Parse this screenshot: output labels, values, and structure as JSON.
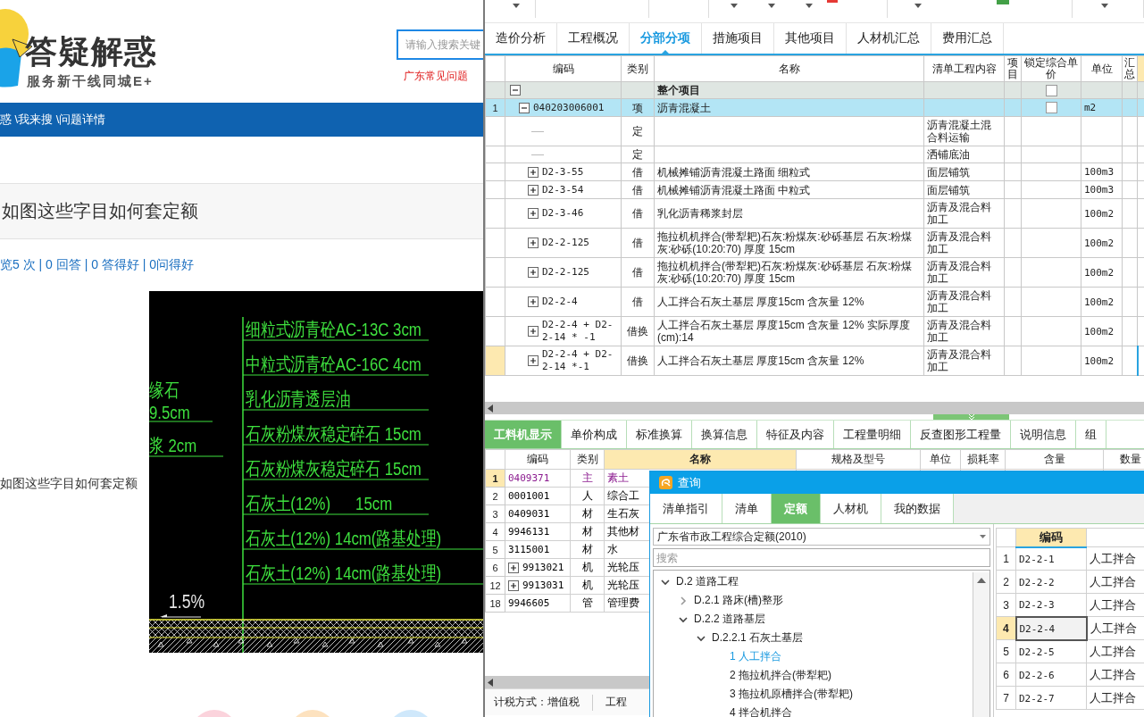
{
  "site": {
    "title": "答疑解惑",
    "slogan": "服务新干线同城E+",
    "search": {
      "placeholder": "请输入搜索关键"
    },
    "hot_link": "广东常见问题"
  },
  "breadcrumb": "惑 \\我来搜 \\问题详情",
  "question": {
    "title": "如图这些字目如何套定额",
    "stats": "览5 次 | 0 回答 | 0 答得好 | 0问得好",
    "body": "如图这些字目如何套定额",
    "cad": {
      "side_labels": [
        "缘石",
        "9.5cm",
        "浆 2cm"
      ],
      "layers": [
        "细粒式沥青砼AC-13C 3cm",
        "中粒式沥青砼AC-16C 4cm",
        "乳化沥青透层油",
        "石灰粉煤灰稳定碎石 15cm",
        "石灰粉煤灰稳定碎石 15cm",
        "石灰土(12%)      15cm",
        "石灰土(12%) 14cm(路基处理)",
        "石灰土(12%) 14cm(路基处理)"
      ],
      "slope": "1.5%"
    }
  },
  "app": {
    "main_tabs": [
      {
        "label": "造价分析",
        "selected": false
      },
      {
        "label": "工程概况",
        "selected": false
      },
      {
        "label": "分部分项",
        "selected": true
      },
      {
        "label": "措施项目",
        "selected": false
      },
      {
        "label": "其他项目",
        "selected": false
      },
      {
        "label": "人材机汇总",
        "selected": false
      },
      {
        "label": "费用汇总",
        "selected": false
      }
    ],
    "main_table": {
      "columns": [
        "编码",
        "类别",
        "名称",
        "清单工程内容",
        "项目",
        "锁定综合单价",
        "单位",
        "汇总"
      ],
      "rows": [
        {
          "kind": "group",
          "num": "",
          "code": "",
          "type": "",
          "name": "整个项目",
          "content": "",
          "unit": "",
          "expanded": true,
          "locked": false,
          "selected": false,
          "current": false
        },
        {
          "kind": "item",
          "num": "1",
          "code": "040203006001",
          "type": "项",
          "name": "沥青混凝土",
          "content": "",
          "unit": "m2",
          "expanded": true,
          "locked": false,
          "selected": true,
          "current": false
        },
        {
          "kind": "sub",
          "num": "",
          "code": "",
          "type": "定",
          "name": "",
          "content": "沥青混凝土混合料运输",
          "unit": "",
          "selected": false,
          "current": false
        },
        {
          "kind": "sub",
          "num": "",
          "code": "",
          "type": "定",
          "name": "",
          "content": "洒铺底油",
          "unit": "",
          "selected": false,
          "current": false
        },
        {
          "kind": "sub",
          "num": "",
          "code": "D2-3-55",
          "type": "借",
          "name": "机械摊铺沥青混凝土路面 细粒式",
          "content": "面层铺筑",
          "unit": "100m3",
          "expanded": false,
          "selected": false,
          "current": false
        },
        {
          "kind": "sub",
          "num": "",
          "code": "D2-3-54",
          "type": "借",
          "name": "机械摊铺沥青混凝土路面 中粒式",
          "content": "面层铺筑",
          "unit": "100m3",
          "expanded": false,
          "selected": false,
          "current": false
        },
        {
          "kind": "sub",
          "num": "",
          "code": "D2-3-46",
          "type": "借",
          "name": "乳化沥青稀浆封层",
          "content": "沥青及混合料加工",
          "unit": "100m2",
          "expanded": false,
          "selected": false,
          "current": false
        },
        {
          "kind": "sub",
          "num": "",
          "code": "D2-2-125",
          "type": "借",
          "name": "拖拉机机拌合(带犁耙)石灰:粉煤灰:砂砾基层 石灰:粉煤灰:砂砾(10:20:70) 厚度 15cm",
          "content": "沥青及混合料加工",
          "unit": "100m2",
          "expanded": false,
          "selected": false,
          "current": false
        },
        {
          "kind": "sub",
          "num": "",
          "code": "D2-2-125",
          "type": "借",
          "name": "拖拉机机拌合(带犁耙)石灰:粉煤灰:砂砾基层 石灰:粉煤灰:砂砾(10:20:70) 厚度 15cm",
          "content": "沥青及混合料加工",
          "unit": "100m2",
          "expanded": false,
          "selected": false,
          "current": false
        },
        {
          "kind": "sub",
          "num": "",
          "code": "D2-2-4",
          "type": "借",
          "name": "人工拌合石灰土基层 厚度15cm 含灰量 12%",
          "content": "沥青及混合料加工",
          "unit": "100m2",
          "expanded": false,
          "selected": false,
          "current": false
        },
        {
          "kind": "sub",
          "num": "",
          "code": "D2-2-4 + D2-2-14 * -1",
          "type": "借换",
          "name": "人工拌合石灰土基层 厚度15cm 含灰量 12%  实际厚度(cm):14",
          "content": "沥青及混合料加工",
          "unit": "100m2",
          "expanded": false,
          "selected": false,
          "current": false
        },
        {
          "kind": "sub",
          "num": "",
          "code": "D2-2-4 + D2-2-14 *-1",
          "type": "借换",
          "name": "人工拌合石灰土基层 厚度15cm 含灰量 12%",
          "content": "沥青及混合料加工",
          "unit": "100m2",
          "expanded": false,
          "selected": false,
          "current": true
        }
      ]
    },
    "detail_tabs": [
      {
        "label": "工料机显示",
        "selected": true
      },
      {
        "label": "单价构成",
        "selected": false
      },
      {
        "label": "标准换算",
        "selected": false
      },
      {
        "label": "换算信息",
        "selected": false
      },
      {
        "label": "特征及内容",
        "selected": false
      },
      {
        "label": "工程量明细",
        "selected": false
      },
      {
        "label": "反查图形工程量",
        "selected": false
      },
      {
        "label": "说明信息",
        "selected": false
      },
      {
        "label": "组",
        "selected": false
      }
    ],
    "detail_table": {
      "columns": [
        {
          "label": "编码",
          "selected": false
        },
        {
          "label": "类别",
          "selected": false
        },
        {
          "label": "名称",
          "selected": true
        },
        {
          "label": "规格及型号",
          "selected": false
        },
        {
          "label": "单位",
          "selected": false
        },
        {
          "label": "损耗率",
          "selected": false
        },
        {
          "label": "含量",
          "selected": false
        },
        {
          "label": "数量",
          "selected": false
        }
      ],
      "rows": [
        {
          "num": "1",
          "code": "0409371",
          "type": "主",
          "name": "素土",
          "color": "#8b1a8f",
          "current": true
        },
        {
          "num": "2",
          "code": "0001001",
          "type": "人",
          "name": "综合工",
          "color": "#000000",
          "current": false
        },
        {
          "num": "3",
          "code": "0409031",
          "type": "材",
          "name": "生石灰",
          "color": "#000000",
          "current": false
        },
        {
          "num": "4",
          "code": "9946131",
          "type": "材",
          "name": "其他材",
          "color": "#000000",
          "current": false
        },
        {
          "num": "5",
          "code": "3115001",
          "type": "材",
          "name": "水",
          "color": "#000000",
          "current": false
        },
        {
          "num": "6",
          "code": "9913021",
          "type": "机",
          "name": "光轮压",
          "color": "#000000",
          "current": false,
          "expanded": false
        },
        {
          "num": "12",
          "code": "9913031",
          "type": "机",
          "name": "光轮压",
          "color": "#000000",
          "current": false,
          "expanded": false
        },
        {
          "num": "18",
          "code": "9946605",
          "type": "管",
          "name": "管理费",
          "color": "#000000",
          "current": false
        }
      ]
    },
    "status": [
      "计税方式：增值税",
      "工程"
    ],
    "dialog": {
      "title": "查询",
      "tabs": [
        {
          "label": "清单指引",
          "selected": false
        },
        {
          "label": "清单",
          "selected": false
        },
        {
          "label": "定额",
          "selected": true
        },
        {
          "label": "人材机",
          "selected": false
        },
        {
          "label": "我的数据",
          "selected": false
        }
      ],
      "library": "广东省市政工程综合定额(2010)",
      "search": {
        "placeholder": "搜索"
      },
      "tree": [
        {
          "label": "D.2 道路工程",
          "expanded": true,
          "children": [
            {
              "label": "D.2.1 路床(槽)整形",
              "expanded": false
            },
            {
              "label": "D.2.2 道路基层",
              "expanded": true,
              "children": [
                {
                  "label": "D.2.2.1 石灰土基层",
                  "expanded": true,
                  "children": [
                    {
                      "label": "1 人工拌合",
                      "selected": true
                    },
                    {
                      "label": "2 拖拉机拌合(带犁耙)",
                      "selected": false
                    },
                    {
                      "label": "3 拖拉机原槽拌合(带犁耙)",
                      "selected": false
                    },
                    {
                      "label": "4 拌合机拌合",
                      "selected": false
                    }
                  ]
                }
              ]
            }
          ]
        }
      ],
      "table": {
        "columns": [
          "编码"
        ],
        "rows": [
          {
            "num": "1",
            "code": "D2-2-1",
            "name": "人工拌合",
            "selected": false
          },
          {
            "num": "2",
            "code": "D2-2-2",
            "name": "人工拌合",
            "selected": false
          },
          {
            "num": "3",
            "code": "D2-2-3",
            "name": "人工拌合",
            "selected": false
          },
          {
            "num": "4",
            "code": "D2-2-4",
            "name": "人工拌合",
            "selected": true
          },
          {
            "num": "5",
            "code": "D2-2-5",
            "name": "人工拌合",
            "selected": false
          },
          {
            "num": "6",
            "code": "D2-2-6",
            "name": "人工拌合",
            "selected": false
          },
          {
            "num": "7",
            "code": "D2-2-7",
            "name": "人工拌合",
            "selected": false
          }
        ]
      }
    }
  }
}
